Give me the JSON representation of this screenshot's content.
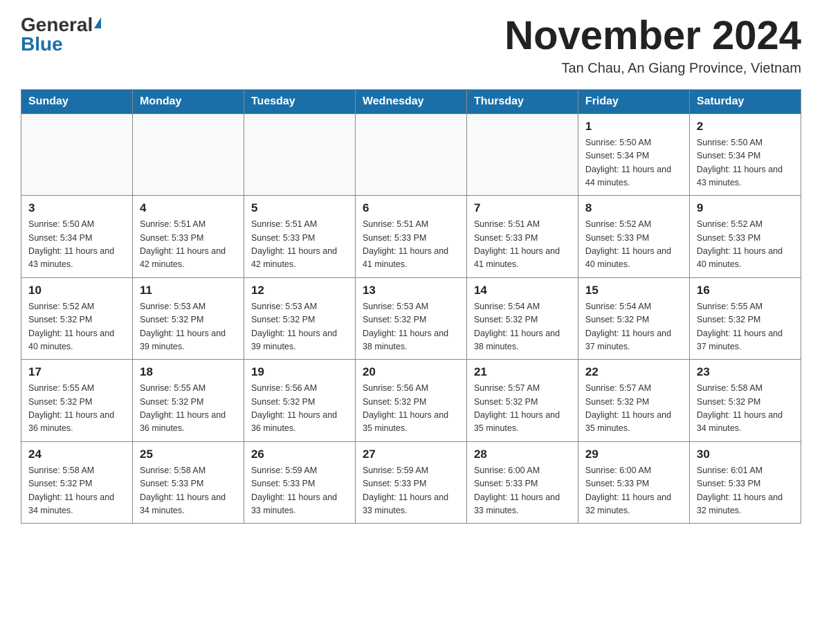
{
  "header": {
    "logo_general": "General",
    "logo_blue": "Blue",
    "month_title": "November 2024",
    "location": "Tan Chau, An Giang Province, Vietnam"
  },
  "days_of_week": [
    "Sunday",
    "Monday",
    "Tuesday",
    "Wednesday",
    "Thursday",
    "Friday",
    "Saturday"
  ],
  "weeks": [
    {
      "cells": [
        {
          "day": "",
          "info": ""
        },
        {
          "day": "",
          "info": ""
        },
        {
          "day": "",
          "info": ""
        },
        {
          "day": "",
          "info": ""
        },
        {
          "day": "",
          "info": ""
        },
        {
          "day": "1",
          "info": "Sunrise: 5:50 AM\nSunset: 5:34 PM\nDaylight: 11 hours\nand 44 minutes."
        },
        {
          "day": "2",
          "info": "Sunrise: 5:50 AM\nSunset: 5:34 PM\nDaylight: 11 hours\nand 43 minutes."
        }
      ]
    },
    {
      "cells": [
        {
          "day": "3",
          "info": "Sunrise: 5:50 AM\nSunset: 5:34 PM\nDaylight: 11 hours\nand 43 minutes."
        },
        {
          "day": "4",
          "info": "Sunrise: 5:51 AM\nSunset: 5:33 PM\nDaylight: 11 hours\nand 42 minutes."
        },
        {
          "day": "5",
          "info": "Sunrise: 5:51 AM\nSunset: 5:33 PM\nDaylight: 11 hours\nand 42 minutes."
        },
        {
          "day": "6",
          "info": "Sunrise: 5:51 AM\nSunset: 5:33 PM\nDaylight: 11 hours\nand 41 minutes."
        },
        {
          "day": "7",
          "info": "Sunrise: 5:51 AM\nSunset: 5:33 PM\nDaylight: 11 hours\nand 41 minutes."
        },
        {
          "day": "8",
          "info": "Sunrise: 5:52 AM\nSunset: 5:33 PM\nDaylight: 11 hours\nand 40 minutes."
        },
        {
          "day": "9",
          "info": "Sunrise: 5:52 AM\nSunset: 5:33 PM\nDaylight: 11 hours\nand 40 minutes."
        }
      ]
    },
    {
      "cells": [
        {
          "day": "10",
          "info": "Sunrise: 5:52 AM\nSunset: 5:32 PM\nDaylight: 11 hours\nand 40 minutes."
        },
        {
          "day": "11",
          "info": "Sunrise: 5:53 AM\nSunset: 5:32 PM\nDaylight: 11 hours\nand 39 minutes."
        },
        {
          "day": "12",
          "info": "Sunrise: 5:53 AM\nSunset: 5:32 PM\nDaylight: 11 hours\nand 39 minutes."
        },
        {
          "day": "13",
          "info": "Sunrise: 5:53 AM\nSunset: 5:32 PM\nDaylight: 11 hours\nand 38 minutes."
        },
        {
          "day": "14",
          "info": "Sunrise: 5:54 AM\nSunset: 5:32 PM\nDaylight: 11 hours\nand 38 minutes."
        },
        {
          "day": "15",
          "info": "Sunrise: 5:54 AM\nSunset: 5:32 PM\nDaylight: 11 hours\nand 37 minutes."
        },
        {
          "day": "16",
          "info": "Sunrise: 5:55 AM\nSunset: 5:32 PM\nDaylight: 11 hours\nand 37 minutes."
        }
      ]
    },
    {
      "cells": [
        {
          "day": "17",
          "info": "Sunrise: 5:55 AM\nSunset: 5:32 PM\nDaylight: 11 hours\nand 36 minutes."
        },
        {
          "day": "18",
          "info": "Sunrise: 5:55 AM\nSunset: 5:32 PM\nDaylight: 11 hours\nand 36 minutes."
        },
        {
          "day": "19",
          "info": "Sunrise: 5:56 AM\nSunset: 5:32 PM\nDaylight: 11 hours\nand 36 minutes."
        },
        {
          "day": "20",
          "info": "Sunrise: 5:56 AM\nSunset: 5:32 PM\nDaylight: 11 hours\nand 35 minutes."
        },
        {
          "day": "21",
          "info": "Sunrise: 5:57 AM\nSunset: 5:32 PM\nDaylight: 11 hours\nand 35 minutes."
        },
        {
          "day": "22",
          "info": "Sunrise: 5:57 AM\nSunset: 5:32 PM\nDaylight: 11 hours\nand 35 minutes."
        },
        {
          "day": "23",
          "info": "Sunrise: 5:58 AM\nSunset: 5:32 PM\nDaylight: 11 hours\nand 34 minutes."
        }
      ]
    },
    {
      "cells": [
        {
          "day": "24",
          "info": "Sunrise: 5:58 AM\nSunset: 5:32 PM\nDaylight: 11 hours\nand 34 minutes."
        },
        {
          "day": "25",
          "info": "Sunrise: 5:58 AM\nSunset: 5:33 PM\nDaylight: 11 hours\nand 34 minutes."
        },
        {
          "day": "26",
          "info": "Sunrise: 5:59 AM\nSunset: 5:33 PM\nDaylight: 11 hours\nand 33 minutes."
        },
        {
          "day": "27",
          "info": "Sunrise: 5:59 AM\nSunset: 5:33 PM\nDaylight: 11 hours\nand 33 minutes."
        },
        {
          "day": "28",
          "info": "Sunrise: 6:00 AM\nSunset: 5:33 PM\nDaylight: 11 hours\nand 33 minutes."
        },
        {
          "day": "29",
          "info": "Sunrise: 6:00 AM\nSunset: 5:33 PM\nDaylight: 11 hours\nand 32 minutes."
        },
        {
          "day": "30",
          "info": "Sunrise: 6:01 AM\nSunset: 5:33 PM\nDaylight: 11 hours\nand 32 minutes."
        }
      ]
    }
  ]
}
